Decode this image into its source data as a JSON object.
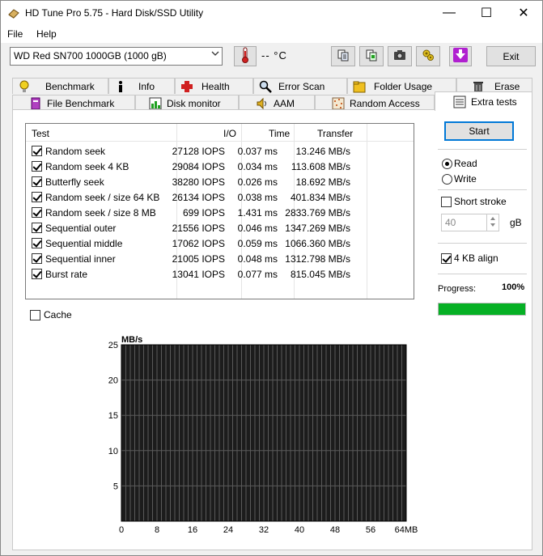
{
  "window": {
    "title": "HD Tune Pro 5.75 - Hard Disk/SSD Utility",
    "minimize": "—",
    "maximize": "☐",
    "close": "✕"
  },
  "menu": {
    "file": "File",
    "help": "Help"
  },
  "toolbar": {
    "drive": "WD Red SN700 1000GB (1000 gB)",
    "temperature": "-- °C",
    "exit_label": "Exit",
    "icons": [
      "copy-icon",
      "copy-all-icon",
      "camera-icon",
      "options-icon",
      "download-icon"
    ]
  },
  "tabs_top": [
    {
      "label": "Benchmark",
      "icon": "benchmark-icon"
    },
    {
      "label": "Info",
      "icon": "info-icon"
    },
    {
      "label": "Health",
      "icon": "health-icon"
    },
    {
      "label": "Error Scan",
      "icon": "error-scan-icon"
    },
    {
      "label": "Folder Usage",
      "icon": "folder-icon"
    },
    {
      "label": "Erase",
      "icon": "erase-icon"
    }
  ],
  "tabs_bottom": [
    {
      "label": "File Benchmark",
      "icon": "file-benchmark-icon"
    },
    {
      "label": "Disk monitor",
      "icon": "disk-monitor-icon"
    },
    {
      "label": "AAM",
      "icon": "speaker-icon"
    },
    {
      "label": "Random Access",
      "icon": "random-access-icon"
    },
    {
      "label": "Extra tests",
      "icon": "extra-tests-icon",
      "active": true
    }
  ],
  "results": {
    "headers": {
      "test": "Test",
      "io": "I/O",
      "time": "Time",
      "transfer": "Transfer"
    },
    "rows": [
      {
        "name": "Random seek",
        "io": "27128 IOPS",
        "time": "0.037 ms",
        "transfer": "13.246 MB/s",
        "checked": true
      },
      {
        "name": "Random seek 4 KB",
        "io": "29084 IOPS",
        "time": "0.034 ms",
        "transfer": "113.608 MB/s",
        "checked": true
      },
      {
        "name": "Butterfly seek",
        "io": "38280 IOPS",
        "time": "0.026 ms",
        "transfer": "18.692 MB/s",
        "checked": true
      },
      {
        "name": "Random seek / size 64 KB",
        "io": "26134 IOPS",
        "time": "0.038 ms",
        "transfer": "401.834 MB/s",
        "checked": true
      },
      {
        "name": "Random seek / size 8 MB",
        "io": "699 IOPS",
        "time": "1.431 ms",
        "transfer": "2833.769 MB/s",
        "checked": true
      },
      {
        "name": "Sequential outer",
        "io": "21556 IOPS",
        "time": "0.046 ms",
        "transfer": "1347.269 MB/s",
        "checked": true
      },
      {
        "name": "Sequential middle",
        "io": "17062 IOPS",
        "time": "0.059 ms",
        "transfer": "1066.360 MB/s",
        "checked": true
      },
      {
        "name": "Sequential inner",
        "io": "21005 IOPS",
        "time": "0.048 ms",
        "transfer": "1312.798 MB/s",
        "checked": true
      },
      {
        "name": "Burst rate",
        "io": "13041 IOPS",
        "time": "0.077 ms",
        "transfer": "815.045 MB/s",
        "checked": true
      }
    ]
  },
  "controls": {
    "start_label": "Start",
    "read_label": "Read",
    "write_label": "Write",
    "mode": "read",
    "short_stroke_label": "Short stroke",
    "short_stroke_checked": false,
    "short_stroke_value": "40",
    "short_stroke_unit": "gB",
    "align_label": "4 KB align",
    "align_checked": true,
    "progress_label": "Progress:",
    "progress_text": "100%",
    "progress_value": 100,
    "cache_label": "Cache",
    "cache_checked": false
  },
  "chart_data": {
    "type": "line",
    "ylabel": "MB/s",
    "xlabel": "",
    "x_unit": "MB",
    "xlim": [
      0,
      64
    ],
    "ylim": [
      0,
      25
    ],
    "x_ticks": [
      0,
      8,
      16,
      24,
      32,
      40,
      48,
      56,
      64
    ],
    "y_ticks": [
      5,
      10,
      15,
      20,
      25
    ],
    "x_tick_labels": [
      "0",
      "8",
      "16",
      "24",
      "32",
      "40",
      "48",
      "56",
      "64MB"
    ],
    "y_tick_labels": [
      "5",
      "10",
      "15",
      "20",
      "25"
    ],
    "grid": true,
    "series": [],
    "colors": {
      "background": "#1c1c1c",
      "grid": "#5a5a5a"
    }
  }
}
